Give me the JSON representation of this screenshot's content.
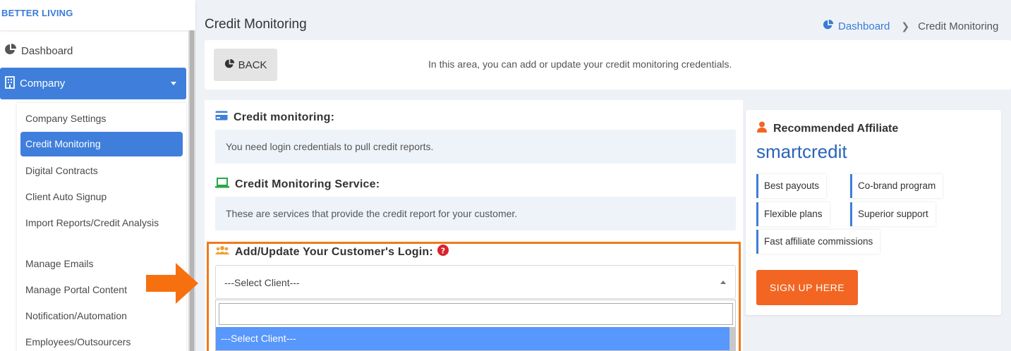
{
  "brand": "BETTER LIVING",
  "sidebar": {
    "dashboard_label": "Dashboard",
    "company_label": "Company",
    "submenu": [
      "Company Settings",
      "Credit Monitoring",
      "Digital Contracts",
      "Client Auto Signup",
      "Import Reports/Credit Analysis",
      "Manage Emails",
      "Manage Portal Content",
      "Notification/Automation",
      "Employees/Outsourcers"
    ],
    "active_index": 1
  },
  "header": {
    "title": "Credit Monitoring",
    "breadcrumb": {
      "home": "Dashboard",
      "current": "Credit Monitoring"
    }
  },
  "topcard": {
    "back_label": "BACK",
    "info": "In this area, you can add or update your credit monitoring credentials."
  },
  "sections": {
    "credit_monitoring_title": "Credit monitoring:",
    "credit_monitoring_text": "You need login credentials to pull credit reports.",
    "service_title": "Credit Monitoring Service:",
    "service_text": "These are services that provide the credit report for your customer.",
    "login_title": "Add/Update Your Customer's Login:"
  },
  "select": {
    "selected": "---Select Client---",
    "search_value": "",
    "options": [
      "---Select Client---"
    ]
  },
  "affiliate": {
    "title": "Recommended Affiliate",
    "brand_name": "smartcredit",
    "features": [
      "Best payouts",
      "Co-brand program",
      "Flexible plans",
      "Superior support",
      "Fast affiliate commissions"
    ],
    "signup_label": "SIGN UP HERE"
  },
  "colors": {
    "primary": "#3f7fdb",
    "highlight_border": "#f07a1a",
    "signup": "#f26522",
    "help_icon": "#d9232d"
  }
}
